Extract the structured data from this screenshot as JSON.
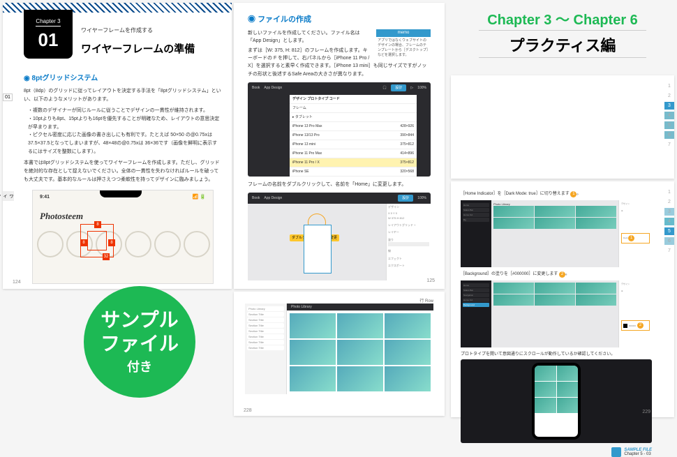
{
  "left": {
    "chapter_label": "Chapter 3",
    "chapter_num": "01",
    "eyebrow": "ワイヤーフレームを作成する",
    "title": "ワイヤーフレームの準備",
    "side_num": "01",
    "side_text": "ワイヤーフレームの準備",
    "h1": "8ptグリッドシステム",
    "p1": "8pt（8dp）のグリッドに従ってレイアウトを決定する手法を「8ptグリッドシステム」といい、以下のようなメリットがあります。",
    "b1": "複数のデザイナーが同じルールに従うことでデザインの一貫性が維持されます。",
    "b2": "10ptよりも8pt、15ptよりも16ptを優先することが明確なため、レイアウトの意思決定が早まります。",
    "b3": "ピクセル密度に応じた画像の書き出しにも有利です。たとえば 50×50 の@0.75xは37.5×37.5となってしまいますが、48×48の@0.75xは 36×36です（画像を鮮明に表示するにはサイズを整数にします）。",
    "p2": "本書では8ptグリッドシステムを使ってワイヤーフレームを作成します。ただし、グリッドを絶対的な存在として捉えないでください。全体の一貫性を失わなければルールを破っても大丈夫です。基本的なルールは押さえつつ柔軟性を持ってデザインに臨みましょう。",
    "mock_time": "9:41",
    "mock_brand": "Photosteem",
    "pagenum": "124"
  },
  "center": {
    "h1": "ファイルの作成",
    "p1": "新しいファイルを作成してください。ファイル名は「App Design」とします。",
    "p2": "まずは［W: 375, H: 812］のフレームを作成します。キーボードの F を押して、右パネルから［iPhone 11 Pro / X］を選択すると素早く作成できます。［iPhone 13 mini］も同じサイズですがノッチの形状と後述するSafe Areaの大きさが異なります。",
    "memo_head": "memo",
    "memo_body": "アプリではなくウェブサイトのデザインの場合、フレームのテンプレートから［デスクトップ］などを選択します。",
    "app_back": "Book",
    "app_name": "App Design",
    "app_tab": "設計",
    "app_pct": "100%",
    "list_head1": "デザイン  プロトタイプ  コード",
    "list_head2": "フレーム",
    "list_items": [
      {
        "l": "▸ タブレット",
        "r": ""
      },
      {
        "l": "iPhone 13 Pro Max",
        "r": "428×926"
      },
      {
        "l": "iPhone 13/13 Pro",
        "r": "390×844"
      },
      {
        "l": "iPhone 13 mini",
        "r": "375×812"
      },
      {
        "l": "iPhone 11 Pro Max",
        "r": "414×896"
      },
      {
        "l": "iPhone 11 Pro / X",
        "r": "375×812"
      },
      {
        "l": "iPhone SE",
        "r": "320×568"
      }
    ],
    "p3": "フレームの名前をダブルクリックして、名前を「Home」に変更します。",
    "tip": "ダブルクリックで名前を変更",
    "pagenum": "125"
  },
  "center2": {
    "row_label": "行 Row",
    "pagenum": "228"
  },
  "titlebar": {
    "en": "Chapter 3 〜 Chapter 6",
    "jp": "プラクティス編"
  },
  "right1": {
    "nums": [
      "1",
      "2",
      "3",
      "4",
      "5",
      "6",
      "7"
    ],
    "active": 2
  },
  "right2": {
    "cap1": "［Home Indicator］を［Dark Mode: true］に切り替えます",
    "cap2": "［Background］の塗りを［#000000］に変更します",
    "cap3": "プロトタイプを開いて意図通りにスクロールが動作しているか確認してください。",
    "nums": [
      "1",
      "2",
      "3",
      "4",
      "5",
      "6",
      "7"
    ],
    "active": 4,
    "sf_label": "SAMPLE FILE",
    "sf_text": "Chapter 5 - 03",
    "pagenum": "229"
  },
  "green": {
    "line1": "サンプル",
    "line2": "ファイル",
    "sub": "付き"
  }
}
